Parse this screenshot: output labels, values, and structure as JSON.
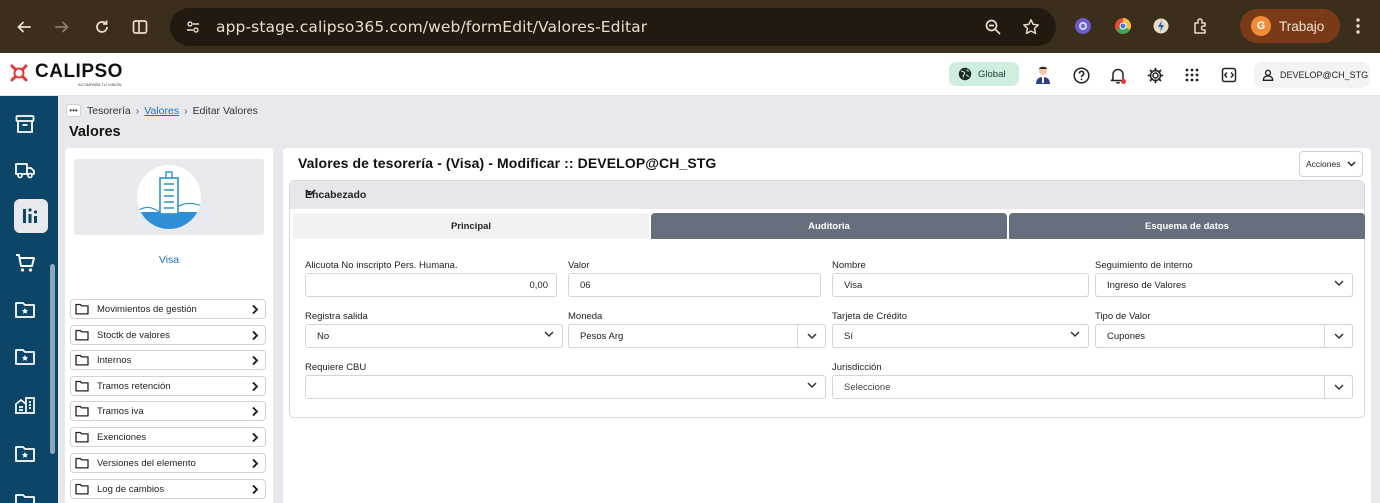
{
  "browser": {
    "url": "app-stage.calipso365.com/web/formEdit/Valores-Editar",
    "profile_initial": "G",
    "profile_name": "Trabajo"
  },
  "app": {
    "logo_text": "CALIPSO",
    "logo_sub": "ACOMPAÑA TU VISIÓN",
    "scope_label": "Global",
    "user_label": "DEVELOP@CH_STG"
  },
  "breadcrumb": {
    "items": [
      "Tesorería",
      "Valores",
      "Editar Valores"
    ]
  },
  "page_title": "Valores",
  "sidebar": {
    "entity_name": "Visa",
    "items": [
      {
        "label": "Movimientos de gestión"
      },
      {
        "label": "Stoctk de valores"
      },
      {
        "label": "Internos"
      },
      {
        "label": "Tramos retención"
      },
      {
        "label": "Tramos iva"
      },
      {
        "label": "Exenciones"
      },
      {
        "label": "Versiones del elemento"
      },
      {
        "label": "Log de cambios"
      }
    ]
  },
  "form": {
    "title": "Valores de tesorería - (Visa) - Modificar :: DEVELOP@CH_STG",
    "actions_label": "Acciones",
    "section_title": "Encabezado",
    "tabs": [
      {
        "label": "Principal",
        "active": true
      },
      {
        "label": "Auditoria",
        "active": false
      },
      {
        "label": "Esquema de datos",
        "active": false
      }
    ],
    "fields": {
      "alicuota": {
        "label": "Alicuota No inscripto Pers. Humana.",
        "value": "0,00"
      },
      "valor": {
        "label": "Valor",
        "value": "06"
      },
      "nombre": {
        "label": "Nombre",
        "value": "Visa"
      },
      "seguimiento": {
        "label": "Seguimiento de interno",
        "value": "Ingreso de Valores"
      },
      "registra_salida": {
        "label": "Registra salida",
        "value": "No"
      },
      "moneda": {
        "label": "Moneda",
        "value": "Pesos Arg"
      },
      "tarjeta_credito": {
        "label": "Tarjeta de Crédito",
        "value": "Sí"
      },
      "tipo_valor": {
        "label": "Tipo de Valor",
        "value": "Cupones"
      },
      "requiere_cbu": {
        "label": "Requiere CBU",
        "value": ""
      },
      "jurisdiccion": {
        "label": "Jurisdicción",
        "placeholder": "Seleccione"
      }
    }
  },
  "colors": {
    "rail": "#0d4568",
    "chrome": "#3c2e1c",
    "link": "#1a73c9",
    "tab_inactive": "#666f7c"
  }
}
